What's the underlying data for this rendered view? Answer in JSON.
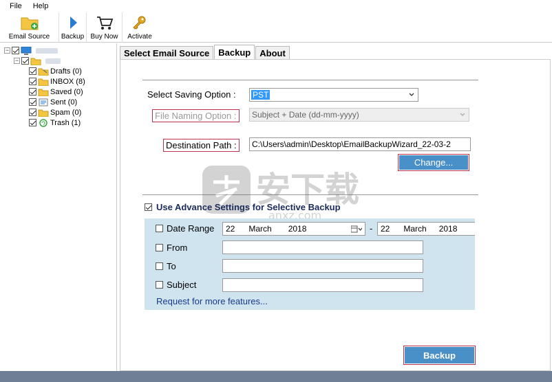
{
  "menu": {
    "file": "File",
    "help": "Help"
  },
  "toolbar": {
    "email_source": "Email Source",
    "backup": "Backup",
    "buy_now": "Buy Now",
    "activate": "Activate"
  },
  "tree": {
    "folders": [
      {
        "name": "Drafts (0)"
      },
      {
        "name": "INBOX (8)"
      },
      {
        "name": "Saved (0)"
      },
      {
        "name": "Sent (0)"
      },
      {
        "name": "Spam (0)"
      },
      {
        "name": "Trash (1)"
      }
    ]
  },
  "tabs": {
    "select_source": "Select Email Source",
    "backup": "Backup",
    "about": "About"
  },
  "form": {
    "saving_label": "Select Saving Option :",
    "saving_value": "PST",
    "naming_label": "File Naming Option :",
    "naming_value": "Subject + Date (dd-mm-yyyy)",
    "dest_label": "Destination Path :",
    "dest_value": "C:\\Users\\admin\\Desktop\\EmailBackupWizard_22-03-2",
    "change_button": "Change..."
  },
  "advanced": {
    "title": "Use Advance Settings for Selective Backup",
    "date_range": "Date Range",
    "from_date": {
      "day": "22",
      "month": "March",
      "year": "2018"
    },
    "separator": "-",
    "to_date": {
      "day": "22",
      "month": "March",
      "year": "2018"
    },
    "from": "From",
    "to": "To",
    "subject": "Subject",
    "request_link": "Request for more features..."
  },
  "backup_button": "Backup",
  "watermark": {
    "text": "安下载",
    "sub": "anxz.com"
  }
}
